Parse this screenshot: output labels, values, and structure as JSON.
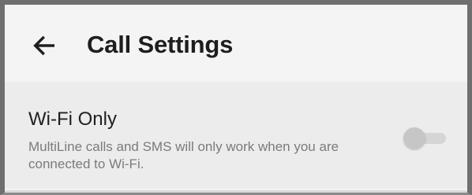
{
  "header": {
    "back_icon": "arrow-left-icon",
    "title": "Call Settings"
  },
  "setting": {
    "title": "Wi-Fi Only",
    "description": "MultiLine calls and SMS will only work when you are connected to Wi-Fi.",
    "toggle_state": "off"
  },
  "colors": {
    "background": "#f3f3f3",
    "setting_background": "#ececec",
    "title_text": "#1e1e1e",
    "description_text": "#7b7b7b",
    "toggle_track": "#d5d5d5",
    "toggle_thumb": "#c6c6c6"
  }
}
